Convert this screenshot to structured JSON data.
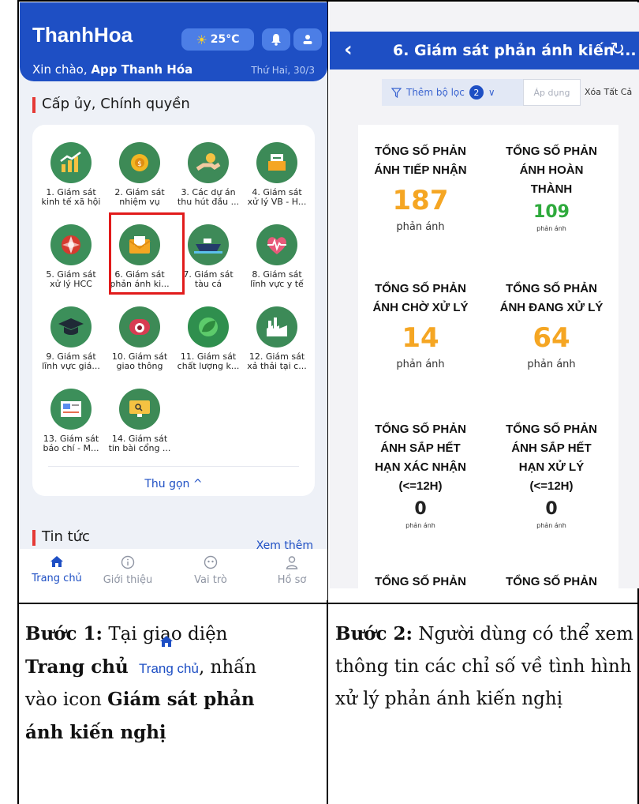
{
  "left_screen": {
    "header": {
      "app_title": "ThanhHoa",
      "weather": "25°C",
      "greeting_prefix": "Xin chào, ",
      "greeting_name": "App Thanh Hóa",
      "date": "Thứ Hai, 30/3"
    },
    "section_title": "Cấp ủy, Chính quyền",
    "apps": [
      {
        "label": "1. Giám sát\nkinh tế xã hội",
        "icon": "chart-growth-icon"
      },
      {
        "label": "2. Giám sát\nnhiệm vụ",
        "icon": "coin-gear-icon"
      },
      {
        "label": "3. Các dự án\nthu hút đầu ...",
        "icon": "hand-coin-icon"
      },
      {
        "label": "4. Giám sát\nxử lý VB - H...",
        "icon": "documents-icon"
      },
      {
        "label": "5. Giám sát\nxử lý HCC",
        "icon": "admin-service-icon"
      },
      {
        "label": "6. Giám sát\nphản ánh ki...",
        "icon": "envelope-icon"
      },
      {
        "label": "7. Giám sát\ntàu cá",
        "icon": "ship-icon"
      },
      {
        "label": "8. Giám sát\nlĩnh vực y tế",
        "icon": "heartbeat-icon"
      },
      {
        "label": "9. Giám sát\nlĩnh vực giá...",
        "icon": "graduation-cap-icon"
      },
      {
        "label": "10. Giám sát\ngiao thông",
        "icon": "camera-icon"
      },
      {
        "label": "11. Giám sát\nchất lượng k...",
        "icon": "leaf-icon"
      },
      {
        "label": "12. Giám sát\nxả thải tại c...",
        "icon": "factory-icon"
      },
      {
        "label": "13. Giám sát\nbáo chí - M...",
        "icon": "newspaper-icon"
      },
      {
        "label": "14. Giám sát\ntin bài cổng ...",
        "icon": "monitor-icon"
      }
    ],
    "collapse_label": "Thu gọn ^",
    "news_title": "Tin tức",
    "news_more": "Xem thêm",
    "tabs": [
      {
        "label": "Trang chủ",
        "icon": "home-icon"
      },
      {
        "label": "Giới thiệu",
        "icon": "info-icon"
      },
      {
        "label": "Vai trò",
        "icon": "role-icon"
      },
      {
        "label": "Hồ sơ",
        "icon": "profile-icon"
      }
    ]
  },
  "right_screen": {
    "title": "6. Giám sát phản ánh kiến ...",
    "filter_label": "Thêm bộ lọc",
    "filter_count": "2",
    "apply_label": "Áp dụng",
    "clear_label": "Xóa Tất Cả",
    "stats": [
      {
        "title": "TỔNG SỐ PHẢN\nÁNH TIẾP NHẬN",
        "value": "187",
        "unit": "phản ánh"
      },
      {
        "title": "TỔNG SỐ PHẢN\nÁNH HOÀN\nTHÀNH",
        "value": "109",
        "unit": "phản ánh"
      },
      {
        "title": "TỔNG SỐ PHẢN\nÁNH CHỜ XỬ LÝ",
        "value": "14",
        "unit": "phản ánh"
      },
      {
        "title": "TỔNG SỐ PHẢN\nÁNH ĐANG XỬ LÝ",
        "value": "64",
        "unit": "phản ánh"
      },
      {
        "title": "TỔNG SỐ PHẢN\nÁNH SẮP HẾT\nHẠN XÁC NHẬN\n(<=12H)",
        "value": "0",
        "unit": "phản ánh"
      },
      {
        "title": "TỔNG SỐ PHẢN\nÁNH SẮP HẾT\nHẠN XỬ LÝ\n(<=12H)",
        "value": "0",
        "unit": "phản ánh"
      },
      {
        "title": "TỔNG SỐ PHẢN",
        "value": "",
        "unit": ""
      },
      {
        "title": "TỔNG SỐ PHẢN",
        "value": "",
        "unit": ""
      }
    ],
    "colors": {
      "orange": "#f5a623",
      "green": "#2eaa3c"
    }
  },
  "captions": {
    "step1_label": "Bước 1:",
    "step1_text_a": " Tại giao diện",
    "step1_bold_b": "Trang chủ",
    "step1_icon_label": "Trang chủ",
    "step1_text_c": ", nhấn",
    "step1_text_d": "vào icon ",
    "step1_bold_e": "Giám sát phản",
    "step1_bold_f": "ánh kiến nghị",
    "step2_label": "Bước 2:",
    "step2_text": " Người dùng có thể xem thông tin các chỉ số về tình hình xử lý phản ánh kiến nghị"
  }
}
